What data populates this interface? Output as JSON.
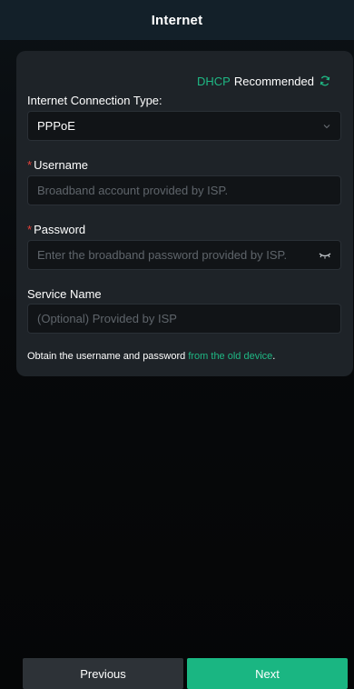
{
  "header": {
    "title": "Internet"
  },
  "dhcp": {
    "link_label": "DHCP",
    "suffix_label": "Recommended",
    "icon": "refresh-icon"
  },
  "connection_type": {
    "label": "Internet Connection Type:",
    "selected": "PPPoE",
    "icon": "chevron-down-icon"
  },
  "username": {
    "required_mark": "*",
    "label": "Username",
    "placeholder": "Broadband account provided by ISP."
  },
  "password": {
    "required_mark": "*",
    "label": "Password",
    "placeholder": "Enter the broadband password provided by ISP.",
    "icon": "eye-closed-icon"
  },
  "service_name": {
    "label": "Service Name",
    "placeholder": "(Optional) Provided by ISP"
  },
  "note": {
    "text": "Obtain the username and password ",
    "link": "from the old device",
    "end": "."
  },
  "buttons": {
    "previous": "Previous",
    "next": "Next"
  },
  "colors": {
    "accent": "#1ab682",
    "required": "#e5423a",
    "card": "#1e2328",
    "header": "#132029"
  }
}
